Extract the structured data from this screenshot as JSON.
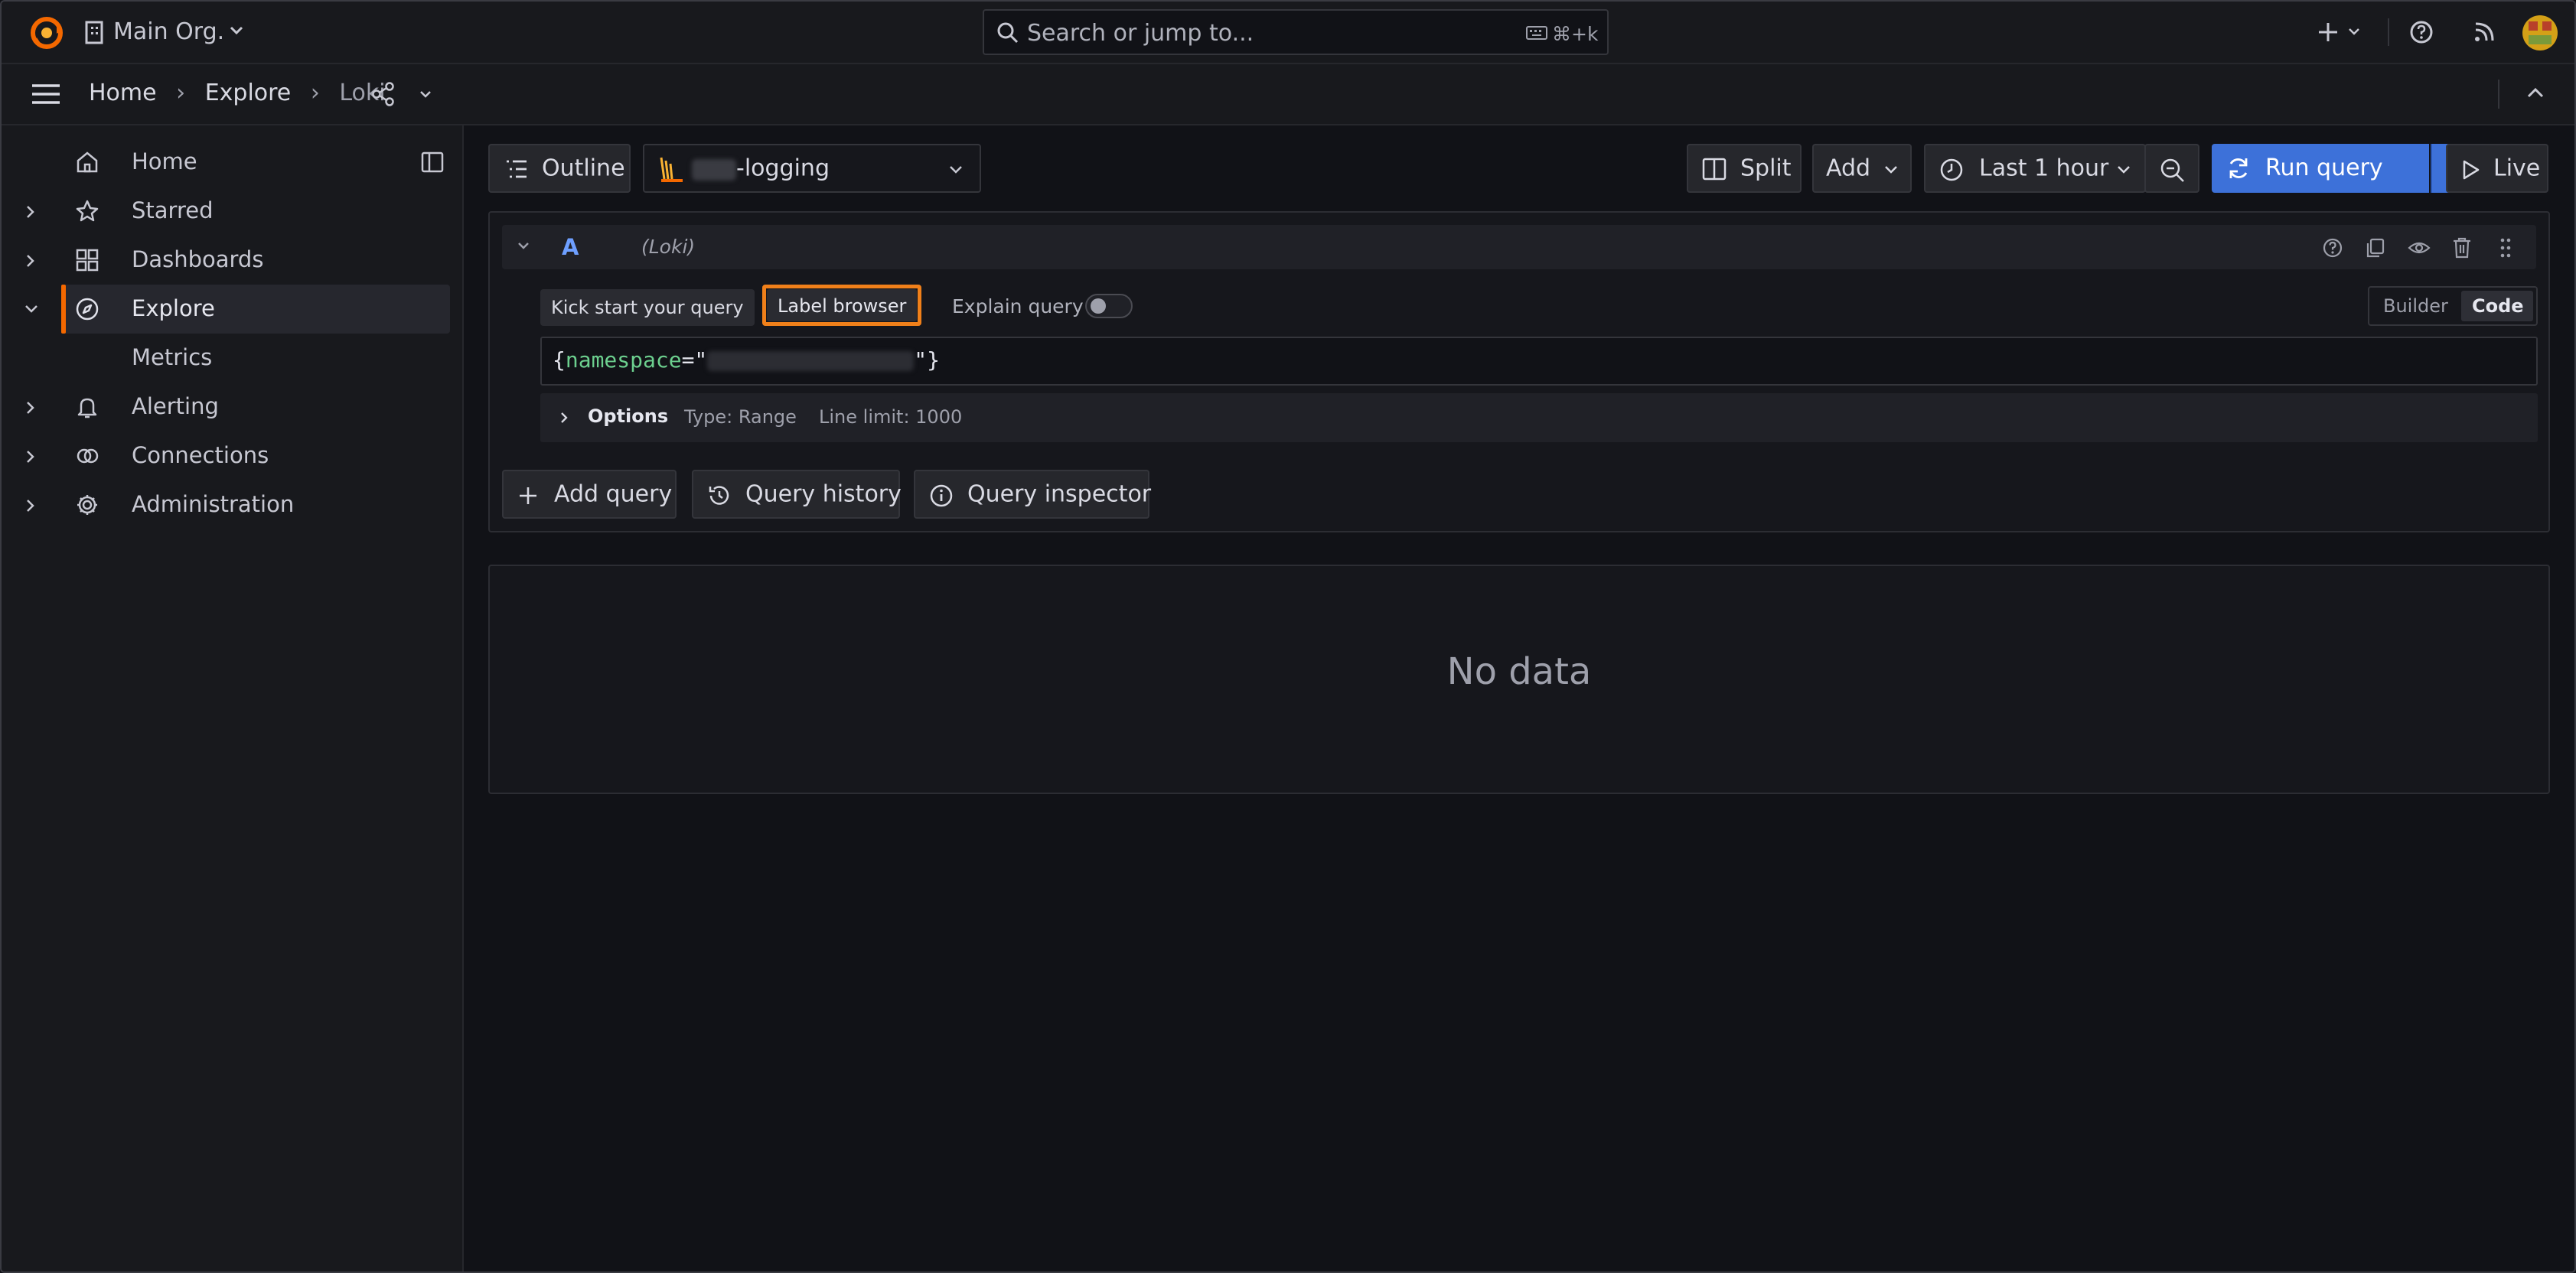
{
  "topbar": {
    "org_label": "Main Org.",
    "search_placeholder": "Search or jump to...",
    "search_shortcut": "⌘+k",
    "icons": [
      "grafana-logo-icon",
      "org-icon",
      "search-icon",
      "keyboard-icon",
      "plus-icon",
      "help-icon",
      "news-icon",
      "avatar"
    ]
  },
  "breadcrumb": {
    "items": [
      "Home",
      "Explore",
      "Loki"
    ]
  },
  "sidebar": {
    "items": [
      {
        "label": "Home",
        "icon": "home-icon"
      },
      {
        "label": "Starred",
        "icon": "star-icon"
      },
      {
        "label": "Dashboards",
        "icon": "dashboards-icon"
      },
      {
        "label": "Explore",
        "icon": "explore-icon",
        "active": true
      },
      {
        "label": "Metrics"
      },
      {
        "label": "Alerting",
        "icon": "bell-icon"
      },
      {
        "label": "Connections",
        "icon": "connections-icon"
      },
      {
        "label": "Administration",
        "icon": "gear-icon"
      }
    ]
  },
  "toolbar": {
    "outline": "Outline",
    "datasource": "-logging",
    "split": "Split",
    "add": "Add",
    "time_range": "Last 1 hour",
    "run_query": "Run query",
    "live": "Live"
  },
  "query": {
    "ref_id": "A",
    "datasource_hint": "(Loki)",
    "kick_start": "Kick start your query",
    "label_browser": "Label browser",
    "explain": "Explain query",
    "mode_builder": "Builder",
    "mode_code": "Code",
    "code_open": "{",
    "code_key": "namespace",
    "code_eq": "=\"",
    "code_close": "\"}",
    "options_label": "Options",
    "options_type": "Type: Range",
    "options_limit": "Line limit: 1000"
  },
  "actions": {
    "add_query": "Add query",
    "query_history": "Query history",
    "query_inspector": "Query inspector"
  },
  "results": {
    "empty": "No data"
  },
  "colors": {
    "accent": "#3d71d9",
    "brand_orange": "#f46800",
    "highlight": "#f0801a",
    "code_key": "#6ccf8e"
  }
}
